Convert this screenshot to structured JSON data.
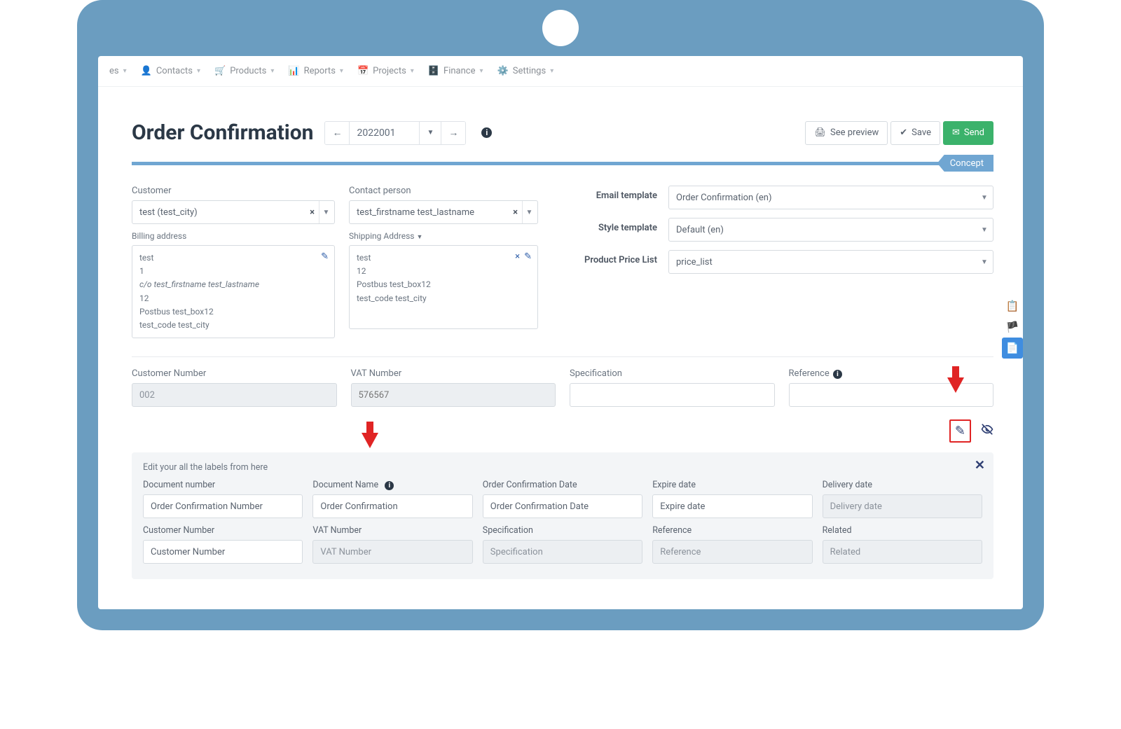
{
  "nav": {
    "truncated": "es",
    "contacts": "Contacts",
    "products": "Products",
    "reports": "Reports",
    "projects": "Projects",
    "finance": "Finance",
    "settings": "Settings"
  },
  "header": {
    "title": "Order Confirmation",
    "doc_number": "2022001",
    "see_preview": "See preview",
    "save": "Save",
    "send": "Send",
    "status": "Concept"
  },
  "customer": {
    "label": "Customer",
    "value": "test (test_city)"
  },
  "contact": {
    "label": "Contact person",
    "value": "test_firstname test_lastname"
  },
  "billing": {
    "label": "Billing address",
    "l1": "test",
    "l2": "1",
    "l3": "c/o test_firstname test_lastname",
    "l4": "12",
    "l5": "Postbus test_box12",
    "l6": "test_code test_city"
  },
  "shipping": {
    "label": "Shipping Address",
    "l1": "test",
    "l2": "12",
    "l3": "Postbus test_box12",
    "l4": "test_code test_city"
  },
  "right": {
    "email_tpl_label": "Email template",
    "email_tpl_value": "Order Confirmation (en)",
    "style_tpl_label": "Style template",
    "style_tpl_value": "Default (en)",
    "price_list_label": "Product Price List",
    "price_list_value": "price_list"
  },
  "row": {
    "cust_num_label": "Customer Number",
    "cust_num_value": "002",
    "vat_label": "VAT Number",
    "vat_value": "576567",
    "vat_placeholder": "576567",
    "spec_label": "Specification",
    "ref_label": "Reference"
  },
  "labels_panel": {
    "title": "Edit your all the labels from here",
    "doc_number_label": "Document number",
    "doc_number_value": "Order Confirmation Number",
    "doc_name_label": "Document Name",
    "doc_name_value": "Order Confirmation",
    "order_date_label": "Order Confirmation Date",
    "order_date_value": "Order Confirmation Date",
    "expire_label": "Expire date",
    "expire_value": "Expire date",
    "delivery_label": "Delivery date",
    "delivery_value": "Delivery date",
    "cust_num_label": "Customer Number",
    "cust_num_value": "Customer Number",
    "vat_label": "VAT Number",
    "vat_value": "VAT Number",
    "spec_label": "Specification",
    "spec_value": "Specification",
    "ref_label": "Reference",
    "ref_value": "Reference",
    "related_label": "Related",
    "related_value": "Related"
  }
}
